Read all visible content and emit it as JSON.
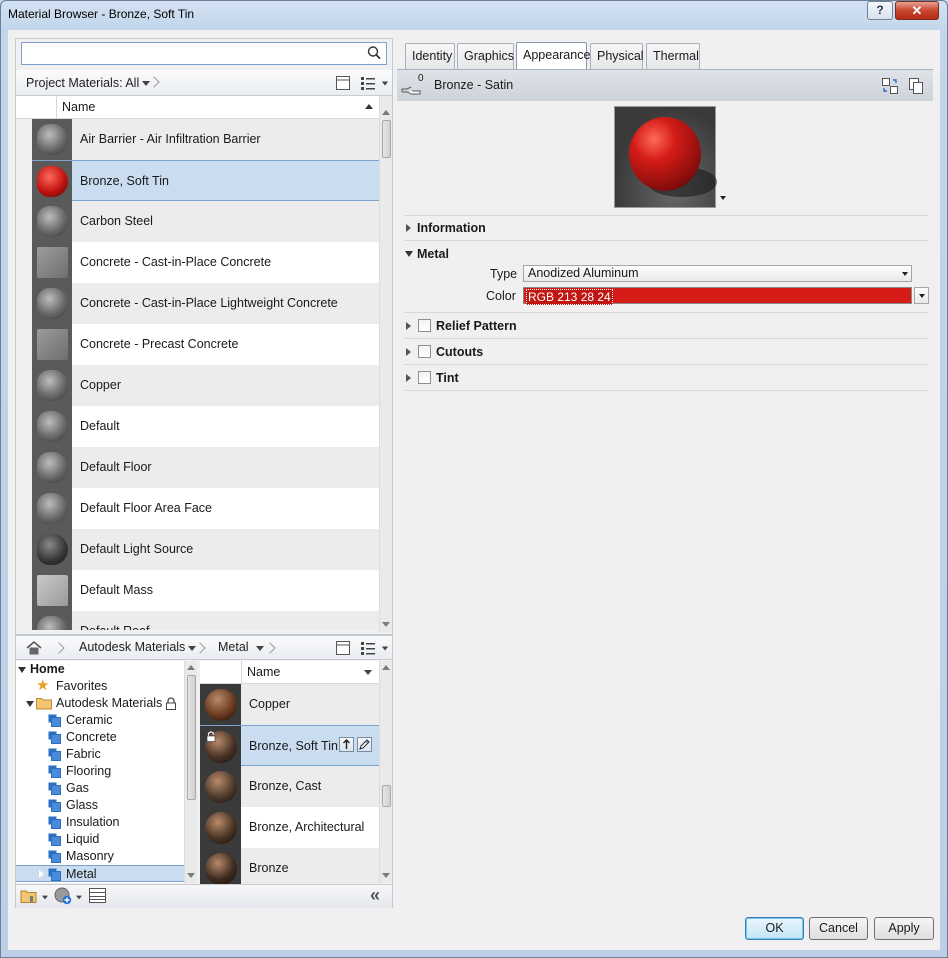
{
  "window": {
    "title": "Material Browser - Bronze, Soft Tin",
    "help_label": "?",
    "close_label": "✕"
  },
  "search": {
    "placeholder": "",
    "value": ""
  },
  "project_bar": {
    "label": "Project Materials: All"
  },
  "project_list": {
    "column_header": "Name",
    "items": [
      {
        "label": "Air Barrier - Air Infiltration Barrier",
        "thumb": "gray-sphere"
      },
      {
        "label": "Bronze, Soft Tin",
        "thumb": "red-sphere",
        "selected": true
      },
      {
        "label": "Carbon Steel",
        "thumb": "gray-sphere"
      },
      {
        "label": "Concrete - Cast-in-Place Concrete",
        "thumb": "concrete-cube"
      },
      {
        "label": "Concrete - Cast-in-Place Lightweight Concrete",
        "thumb": "gray-sphere"
      },
      {
        "label": "Concrete - Precast Concrete",
        "thumb": "concrete-cube"
      },
      {
        "label": "Copper",
        "thumb": "gray-sphere"
      },
      {
        "label": "Default",
        "thumb": "gray-sphere"
      },
      {
        "label": "Default Floor",
        "thumb": "gray-sphere"
      },
      {
        "label": "Default Floor Area Face",
        "thumb": "gray-sphere"
      },
      {
        "label": "Default Light Source",
        "thumb": "dark-sphere"
      },
      {
        "label": "Default Mass",
        "thumb": "mass-cube"
      },
      {
        "label": "Default Roof",
        "thumb": "gray-sphere"
      }
    ]
  },
  "library_bar": {
    "crumb1": "Autodesk Materials",
    "crumb2": "Metal"
  },
  "library_tree": {
    "home": "Home",
    "favorites": "Favorites",
    "library": "Autodesk Materials",
    "categories": [
      "Ceramic",
      "Concrete",
      "Fabric",
      "Flooring",
      "Gas",
      "Glass",
      "Insulation",
      "Liquid",
      "Masonry",
      "Metal"
    ]
  },
  "library_list": {
    "column_header": "Name",
    "items": [
      {
        "label": "Copper",
        "color": "#6b3a1f"
      },
      {
        "label": "Bronze, Soft Tin",
        "color": "#4a3326",
        "selected": true
      },
      {
        "label": "Bronze, Cast",
        "color": "#4e3b2c"
      },
      {
        "label": "Bronze, Architectural",
        "color": "#4a3525"
      },
      {
        "label": "Bronze",
        "color": "#3e2b1f"
      }
    ]
  },
  "tabs": [
    "Identity",
    "Graphics",
    "Appearance",
    "Physical",
    "Thermal"
  ],
  "active_tab": "Appearance",
  "asset": {
    "name": "Bronze - Satin",
    "usage_count": "0"
  },
  "sections": {
    "information": "Information",
    "metal": "Metal",
    "type_label": "Type",
    "type_value": "Anodized Aluminum",
    "color_label": "Color",
    "color_value": "RGB 213 28 24",
    "color_hex": "#d51c18",
    "relief": "Relief Pattern",
    "cutouts": "Cutouts",
    "tint": "Tint"
  },
  "buttons": {
    "ok": "OK",
    "cancel": "Cancel",
    "apply": "Apply",
    "collapse": "«"
  }
}
